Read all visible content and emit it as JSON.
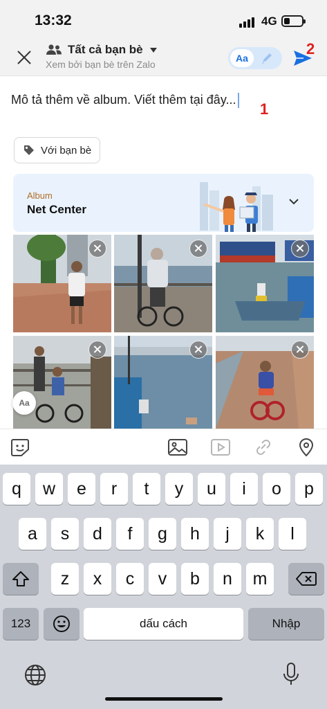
{
  "status_bar": {
    "time": "13:32",
    "network": "4G",
    "battery_level_fraction": 0.35
  },
  "header": {
    "close_icon": "close-icon",
    "audience_title": "Tất cả bạn bè",
    "audience_subtitle": "Xem bởi bạn bè trên Zalo",
    "style_toggle_label": "Aa",
    "send_icon": "send-icon",
    "annotation_send": "2"
  },
  "composer": {
    "caption_placeholder": "Mô tả thêm về album. Viết thêm tại đây...",
    "annotation_caption": "1",
    "tag_button_label": "Với bạn bè"
  },
  "album": {
    "label": "Album",
    "name": "Net Center"
  },
  "photos": {
    "count": 6,
    "items": [
      "boy-walking-on-promenade",
      "man-on-bicycle-at-railing",
      "boats-at-harbor",
      "children-riding-bicycles",
      "river-and-city-skyline",
      "child-on-bicycle-on-path"
    ]
  },
  "font_fab_label": "Aa",
  "toolbar": {
    "icons": [
      "sticker-icon",
      "image-icon",
      "video-icon",
      "link-icon",
      "location-icon"
    ]
  },
  "keyboard": {
    "row1": [
      "q",
      "w",
      "e",
      "r",
      "t",
      "y",
      "u",
      "i",
      "o",
      "p"
    ],
    "row2": [
      "a",
      "s",
      "d",
      "f",
      "g",
      "h",
      "j",
      "k",
      "l"
    ],
    "row3": [
      "z",
      "x",
      "c",
      "v",
      "b",
      "n",
      "m"
    ],
    "numbers_label": "123",
    "space_label": "dấu cách",
    "return_label": "Nhập"
  },
  "colors": {
    "accent_blue": "#1a6fe0",
    "annotation_red": "#e02020",
    "album_label": "#b06e28",
    "keyboard_bg": "#d1d4da"
  }
}
